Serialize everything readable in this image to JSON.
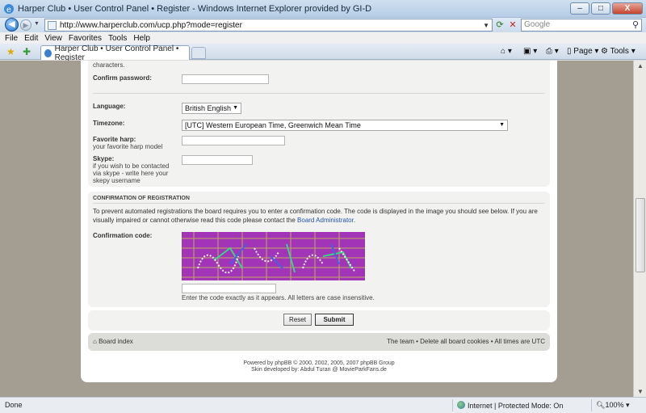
{
  "window": {
    "title": "Harper Club • User Control Panel • Register - Windows Internet Explorer provided by GI-D",
    "minimize": "–",
    "maximize": "□",
    "close": "X"
  },
  "address": {
    "url": "http://www.harperclub.com/ucp.php?mode=register",
    "search_placeholder": "Google"
  },
  "menu": [
    "File",
    "Edit",
    "View",
    "Favorites",
    "Tools",
    "Help"
  ],
  "tab": {
    "label": "Harper Club • User Control Panel • Register"
  },
  "commands": {
    "page": "Page",
    "tools": "Tools"
  },
  "form": {
    "characters_note": "characters.",
    "confirm_password_label": "Confirm password:",
    "language_label": "Language:",
    "language_value": "British English",
    "timezone_label": "Timezone:",
    "timezone_value": "[UTC] Western European Time, Greenwich Mean Time",
    "favorite_harp_label": "Favorite harp:",
    "favorite_harp_sub": "your favorite harp model",
    "skype_label": "Skype:",
    "skype_sub": [
      "if you wish to be contacted",
      "via skype - write here your",
      "skepy username"
    ]
  },
  "confirmation": {
    "title": "CONFIRMATION OF REGISTRATION",
    "text_before_link": "To prevent automated registrations the board requires you to enter a confirmation code. The code is displayed in the image you should see below. If you are visually impaired or cannot otherwise read this code please contact the ",
    "link": "Board Administrator",
    "text_after_link": ".",
    "code_label": "Confirmation code:",
    "hint": "Enter the code exactly as it appears. All letters are case insensitive."
  },
  "buttons": {
    "reset": "Reset",
    "submit": "Submit"
  },
  "footer": {
    "board_index": "Board index",
    "right_links": "The team • Delete all board cookies • All times are UTC",
    "credit1": "Powered by phpBB © 2000, 2002, 2005, 2007 phpBB Group",
    "credit2": "Skin developed by: Abdul Turan @ MovieParkFans.de"
  },
  "status": {
    "text": "Done",
    "zone": "Internet | Protected Mode: On",
    "zoom": "100%"
  }
}
